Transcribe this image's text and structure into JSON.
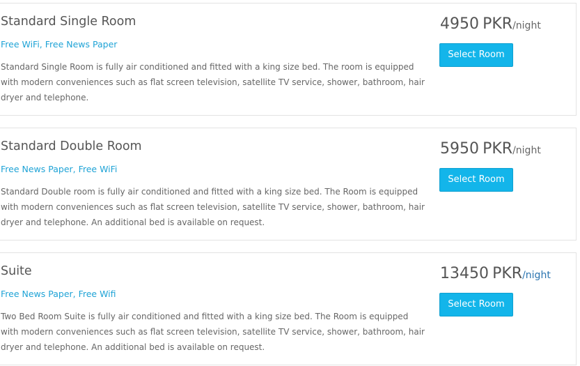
{
  "rooms": [
    {
      "name": "Standard Single Room",
      "amenities": "Free WiFi, Free News Paper",
      "description": "Standard Single Room is fully air conditioned and fitted with a king size bed. The room is equipped with modern conveniences such as flat screen television, satellite TV service, shower, bathroom, hair dryer and telephone.",
      "price": "4950",
      "currency": "PKR",
      "unit": "/night",
      "button_label": "Select Room"
    },
    {
      "name": "Standard Double Room",
      "amenities": "Free News Paper, Free WiFi",
      "description": "Standard Double room is fully air conditioned and fitted with a king size bed. The Room is equipped with modern conveniences such as flat screen television, satellite TV service, shower, bathroom, hair dryer and telephone. An additional bed is available on request.",
      "price": "5950",
      "currency": "PKR",
      "unit": "/night",
      "button_label": "Select Room"
    },
    {
      "name": "Suite",
      "amenities": "Free News Paper, Free Wifi",
      "description": "Two Bed Room Suite is fully air conditioned and fitted with a king size bed. The Room is equipped with modern conveniences such as flat screen television, satellite TV service, shower, bathroom, hair dryer and telephone. An additional bed is available on request.",
      "price": "13450",
      "currency": "PKR",
      "unit": "/night",
      "button_label": "Select Room"
    }
  ],
  "colors": {
    "accent": "#13b5ea",
    "amenity_link": "#1fa3d6",
    "title_text": "#555555",
    "body_text": "#666666",
    "card_border": "#e3e3e3"
  }
}
